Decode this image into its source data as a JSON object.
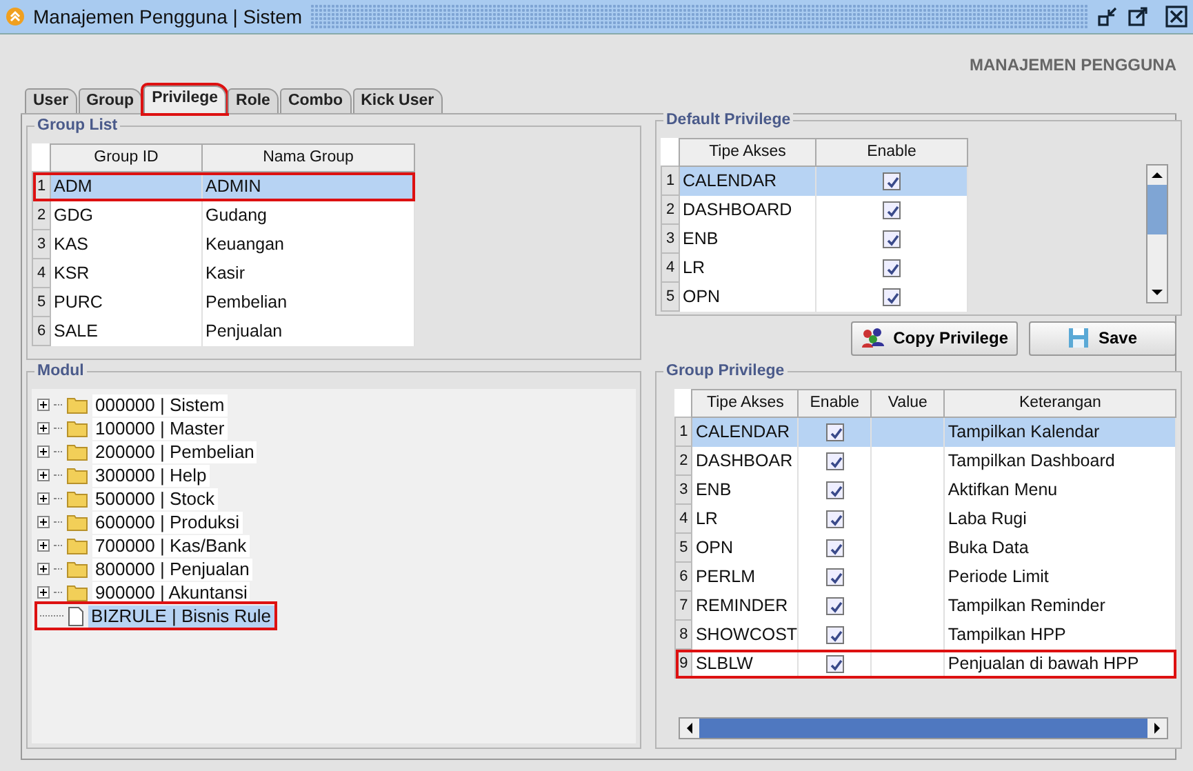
{
  "window": {
    "title": "Manajemen Pengguna | Sistem"
  },
  "header": "MANAJEMEN PENGGUNA",
  "tabs": [
    {
      "label": "User",
      "selected": false,
      "highlighted": false
    },
    {
      "label": "Group",
      "selected": false,
      "highlighted": false
    },
    {
      "label": "Privilege",
      "selected": true,
      "highlighted": true
    },
    {
      "label": "Role",
      "selected": false,
      "highlighted": false
    },
    {
      "label": "Combo",
      "selected": false,
      "highlighted": false
    },
    {
      "label": "Kick User",
      "selected": false,
      "highlighted": false
    }
  ],
  "group_list": {
    "title": "Group List",
    "columns": [
      "Group ID",
      "Nama Group"
    ],
    "rows": [
      {
        "number": "1",
        "cells": [
          "ADM",
          "ADMIN"
        ],
        "selected": true,
        "highlighted": true
      },
      {
        "number": "2",
        "cells": [
          "GDG",
          "Gudang"
        ],
        "selected": false,
        "highlighted": false
      },
      {
        "number": "3",
        "cells": [
          "KAS",
          "Keuangan"
        ],
        "selected": false,
        "highlighted": false
      },
      {
        "number": "4",
        "cells": [
          "KSR",
          "Kasir"
        ],
        "selected": false,
        "highlighted": false
      },
      {
        "number": "5",
        "cells": [
          "PURC",
          "Pembelian"
        ],
        "selected": false,
        "highlighted": false
      },
      {
        "number": "6",
        "cells": [
          "SALE",
          "Penjualan"
        ],
        "selected": false,
        "highlighted": false
      }
    ]
  },
  "default_privilege": {
    "title": "Default Privilege",
    "columns": [
      "Tipe Akses",
      "Enable"
    ],
    "rows": [
      {
        "number": "1",
        "tipe": "CALENDAR",
        "enabled": true,
        "selected": true
      },
      {
        "number": "2",
        "tipe": "DASHBOARD",
        "enabled": true,
        "selected": false
      },
      {
        "number": "3",
        "tipe": "ENB",
        "enabled": true,
        "selected": false
      },
      {
        "number": "4",
        "tipe": "LR",
        "enabled": true,
        "selected": false
      },
      {
        "number": "5",
        "tipe": "OPN",
        "enabled": true,
        "selected": false
      }
    ]
  },
  "buttons": [
    {
      "label": "Copy Privilege",
      "kind": "copy"
    },
    {
      "label": "Save",
      "kind": "save"
    }
  ],
  "modul": {
    "title": "Modul",
    "items": [
      {
        "label": "000000 | Sistem",
        "kind": "folder",
        "expanded": false,
        "selected": false,
        "highlighted": false
      },
      {
        "label": "100000 | Master",
        "kind": "folder",
        "expanded": false,
        "selected": false,
        "highlighted": false
      },
      {
        "label": "200000 | Pembelian",
        "kind": "folder",
        "expanded": false,
        "selected": false,
        "highlighted": false
      },
      {
        "label": "300000 | Help",
        "kind": "folder",
        "expanded": false,
        "selected": false,
        "highlighted": false
      },
      {
        "label": "500000 | Stock",
        "kind": "folder",
        "expanded": false,
        "selected": false,
        "highlighted": false
      },
      {
        "label": "600000 | Produksi",
        "kind": "folder",
        "expanded": false,
        "selected": false,
        "highlighted": false
      },
      {
        "label": "700000 | Kas/Bank",
        "kind": "folder",
        "expanded": false,
        "selected": false,
        "highlighted": false
      },
      {
        "label": "800000 | Penjualan",
        "kind": "folder",
        "expanded": false,
        "selected": false,
        "highlighted": false
      },
      {
        "label": "900000 | Akuntansi",
        "kind": "folder",
        "expanded": false,
        "selected": false,
        "highlighted": false
      },
      {
        "label": "BIZRULE | Bisnis Rule",
        "kind": "file",
        "selected": true,
        "highlighted": true
      }
    ]
  },
  "group_privilege": {
    "title": "Group Privilege",
    "columns": [
      "Tipe Akses",
      "Enable",
      "Value",
      "Keterangan"
    ],
    "rows": [
      {
        "number": "1",
        "tipe": "CALENDAR",
        "enabled": true,
        "keterangan": "Tampilkan Kalendar",
        "selected": true,
        "highlighted": false
      },
      {
        "number": "2",
        "tipe": "DASHBOAR",
        "enabled": true,
        "keterangan": "Tampilkan Dashboard",
        "selected": false,
        "highlighted": false
      },
      {
        "number": "3",
        "tipe": "ENB",
        "enabled": true,
        "keterangan": "Aktifkan Menu",
        "selected": false,
        "highlighted": false
      },
      {
        "number": "4",
        "tipe": "LR",
        "enabled": true,
        "keterangan": "Laba Rugi",
        "selected": false,
        "highlighted": false
      },
      {
        "number": "5",
        "tipe": "OPN",
        "enabled": true,
        "keterangan": "Buka Data",
        "selected": false,
        "highlighted": false
      },
      {
        "number": "6",
        "tipe": "PERLM",
        "enabled": true,
        "keterangan": "Periode Limit",
        "selected": false,
        "highlighted": false
      },
      {
        "number": "7",
        "tipe": "REMINDER",
        "enabled": true,
        "keterangan": "Tampilkan Reminder",
        "selected": false,
        "highlighted": false
      },
      {
        "number": "8",
        "tipe": "SHOWCOST",
        "enabled": true,
        "keterangan": "Tampilkan HPP",
        "selected": false,
        "highlighted": false
      },
      {
        "number": "9",
        "tipe": "SLBLW",
        "enabled": true,
        "keterangan": "Penjualan di bawah HPP",
        "selected": false,
        "highlighted": true
      }
    ]
  }
}
